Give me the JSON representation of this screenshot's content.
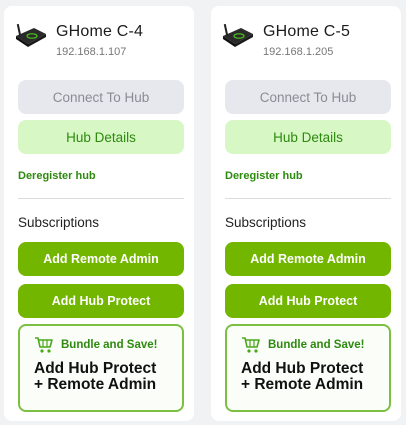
{
  "hubs": [
    {
      "name": "GHome C-4",
      "ip": "192.168.1.107",
      "connect_label": "Connect To Hub",
      "details_label": "Hub Details",
      "deregister_label": "Deregister hub",
      "subscriptions_title": "Subscriptions",
      "remote_admin_label": "Add Remote Admin",
      "hub_protect_label": "Add Hub Protect",
      "bundle_tag": "Bundle and Save!",
      "bundle_line1": "Add Hub Protect",
      "bundle_line2": "+ Remote Admin"
    },
    {
      "name": "GHome C-5",
      "ip": "192.168.1.205",
      "connect_label": "Connect To Hub",
      "details_label": "Hub Details",
      "deregister_label": "Deregister hub",
      "subscriptions_title": "Subscriptions",
      "remote_admin_label": "Add Remote Admin",
      "hub_protect_label": "Add Hub Protect",
      "bundle_tag": "Bundle and Save!",
      "bundle_line1": "Add Hub Protect",
      "bundle_line2": "+ Remote Admin"
    }
  ],
  "colors": {
    "primary_green": "#72b600",
    "link_green": "#2d8a0f",
    "details_bg": "#d7f7c4",
    "disabled_bg": "#e7e8ee",
    "bundle_border": "#7cc043"
  },
  "icons": {
    "hub": "hub-device-icon",
    "cart": "shopping-cart-icon"
  }
}
